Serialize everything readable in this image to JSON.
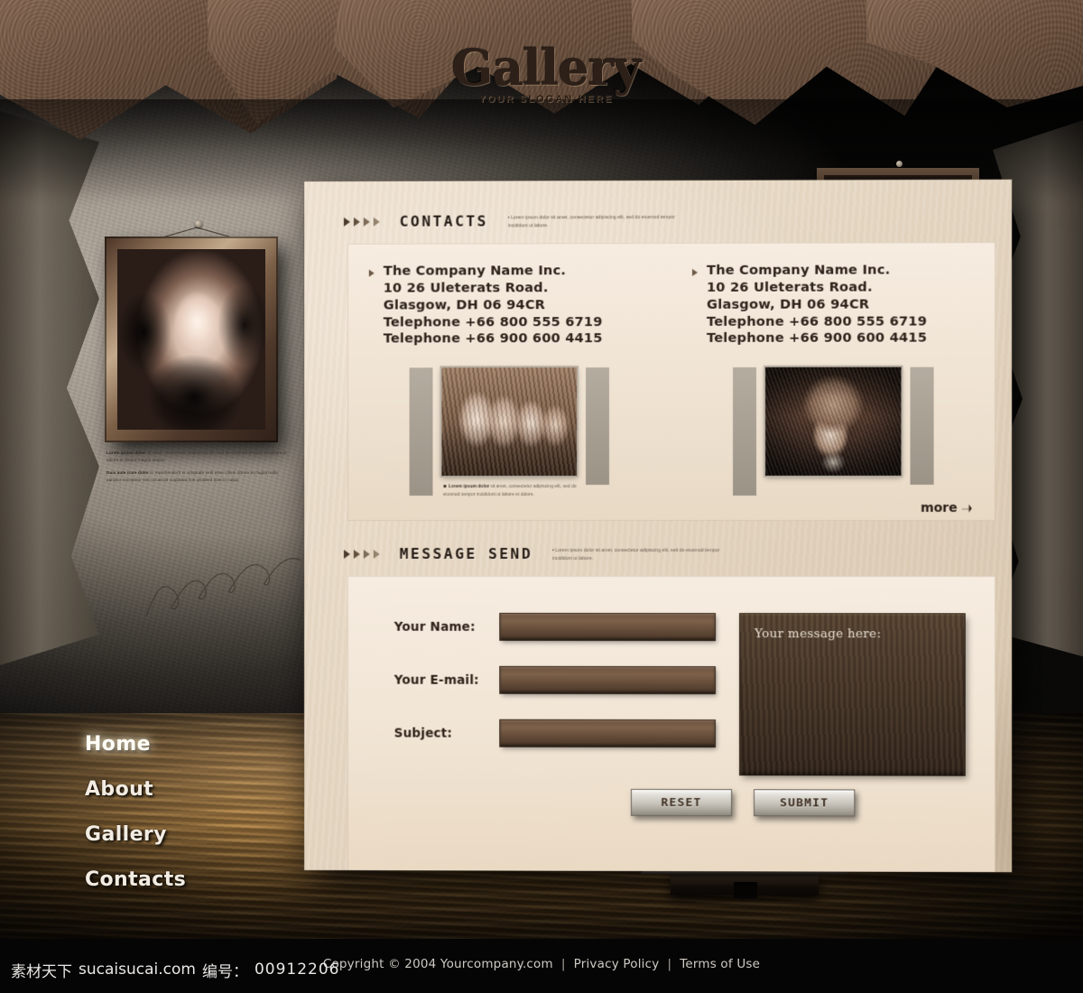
{
  "site": {
    "logo_title": "Gallery",
    "logo_slogan": "YOUR SLOGAN HERE"
  },
  "nav": {
    "items": [
      {
        "label": "Home",
        "active": true
      },
      {
        "label": "About",
        "active": false
      },
      {
        "label": "Gallery",
        "active": false
      },
      {
        "label": "Contacts",
        "active": false
      }
    ]
  },
  "contacts_section": {
    "title": "CONTACTS",
    "lorem": "Lorem ipsum dolor sit amet, consectetur adipiscing elit, sed do eiusmod tempor incididunt ut labore.",
    "columns": [
      {
        "company": "The   Company Name  Inc.",
        "street": "10 26   Uleterats Road.",
        "city": "Glasgow,  DH 06 94CR",
        "phone1": "Telephone +66 800 555 6719",
        "phone2": "Telephone +66 900 600 4415",
        "caption_bold": "Lorem ipsum dolor",
        "caption_text": "sit amet, consectetur adipiscing elit, sed do eiusmod tempor incididunt ut labore et dolore."
      },
      {
        "company": "The   Company Name  Inc.",
        "street": "10 26   Uleterats Road.",
        "city": "Glasgow,  DH 06 94CR",
        "phone1": "Telephone +66 800 555 6719",
        "phone2": "Telephone +66 900 600 4415",
        "caption_bold": "",
        "caption_text": ""
      }
    ],
    "more_label": "more"
  },
  "message_section": {
    "title": "MESSAGE SEND",
    "lorem": "Lorem ipsum dolor sit amet, consectetur adipiscing elit, sed do eiusmod tempor incididunt ut labore.",
    "fields": [
      {
        "label": "Your Name:",
        "value": "",
        "placeholder": ""
      },
      {
        "label": "Your E-mail:",
        "value": "",
        "placeholder": ""
      },
      {
        "label": "Subject:",
        "value": "",
        "placeholder": ""
      }
    ],
    "message": {
      "placeholder": "Your message here:",
      "value": ""
    },
    "reset_label": "RESET",
    "submit_label": "SUBMIT"
  },
  "wall_frame": {
    "caption_bold1": "Lorem ipsum dolor",
    "caption_text1": "sit amet, consectetur adipiscing elit, sed do eiusmod tempor incididunt ut labore et dolore magna aliqua.",
    "caption_bold2": "Duis aute irure dolor",
    "caption_text2": "in reprehenderit in voluptate velit esse cillum dolore eu fugiat nulla pariatur excepteur sint occaecat cupidatat non proident sunt in culpa."
  },
  "footer": {
    "copyright": "Copyright © 2004 Yourcompany.com",
    "privacy": "Privacy Policy",
    "terms": "Terms of Use",
    "separator": "|"
  },
  "watermark": {
    "site_cn": "素材天下",
    "site_url": "sucaisucai.com",
    "id_label": "编号：",
    "id_value": "00912206"
  },
  "colors": {
    "panel_bg": "#e9dcc8",
    "panel_inner": "#f3e8da",
    "text_dark": "#2e2118",
    "input_brown": "#6c5442",
    "textarea_brown": "#3f2f22",
    "nav_text": "#f3ece2",
    "floor_wood": "#9c6d2f",
    "wall_gray": "#8d8478"
  }
}
